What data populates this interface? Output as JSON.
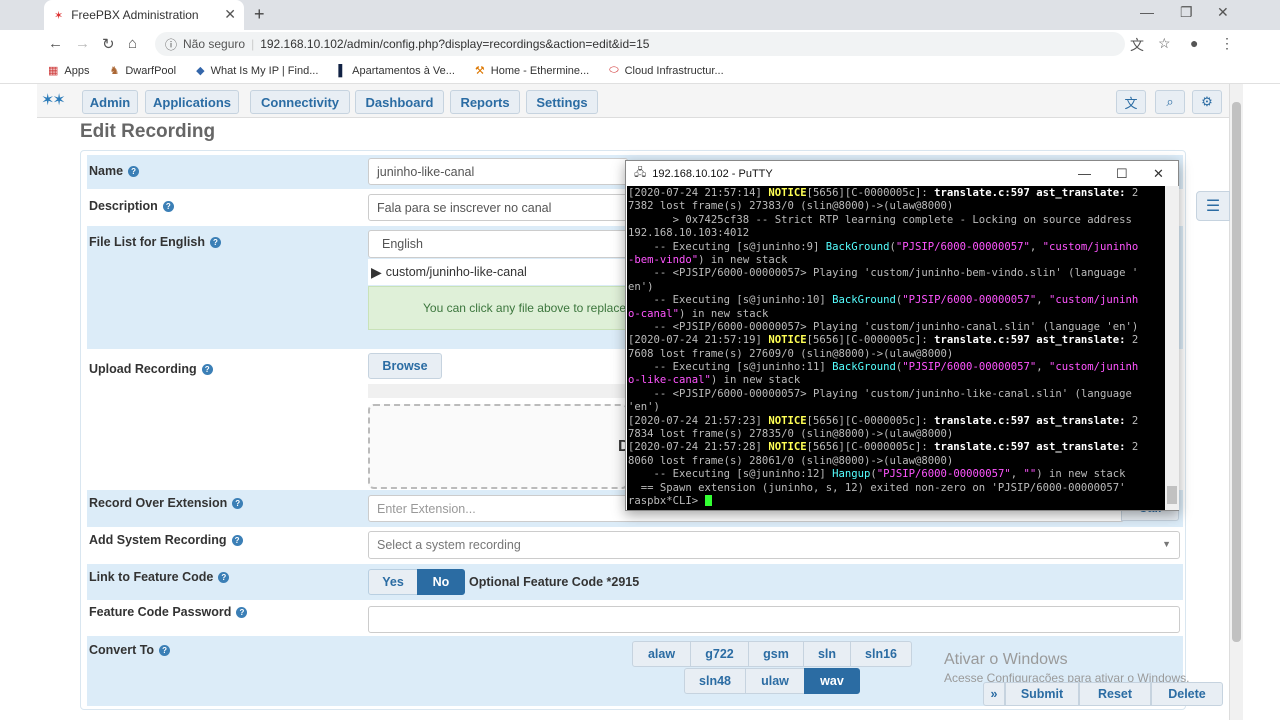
{
  "browser": {
    "tab_title": "FreePBX Administration",
    "security_label": "Não seguro",
    "separator": "|",
    "url": "192.168.10.102/admin/config.php?display=recordings&action=edit&id=15",
    "bookmarks": [
      {
        "label": "Apps"
      },
      {
        "label": "DwarfPool"
      },
      {
        "label": "What Is My IP | Find..."
      },
      {
        "label": "Apartamentos à Ve..."
      },
      {
        "label": "Home - Ethermine..."
      },
      {
        "label": "Cloud Infrastructur..."
      }
    ]
  },
  "nav": {
    "items": [
      "Admin",
      "Applications",
      "Connectivity",
      "Dashboard",
      "Reports",
      "Settings"
    ]
  },
  "page_title": "Edit Recording",
  "form": {
    "name_label": "Name",
    "name_value": "juninho-like-canal",
    "description_label": "Description",
    "description_value": "Fala para se inscrever no canal",
    "filelist_label": "File List for English",
    "language_value": "English",
    "file_item": "custom/juninho-like-canal",
    "file_hint": "You can click any file above to replace",
    "upload_label": "Upload Recording",
    "browse_label": "Browse",
    "drop_partial": "D",
    "record_over_label": "Record Over Extension",
    "record_over_placeholder": "Enter Extension...",
    "call_label": "Call",
    "system_rec_label": "Add System Recording",
    "system_rec_placeholder": "Select a system recording",
    "feature_code_label": "Link to Feature Code",
    "yes_label": "Yes",
    "no_label": "No",
    "feature_code_text": "Optional Feature Code *2915",
    "fc_password_label": "Feature Code Password",
    "convert_label": "Convert To",
    "convert_options": [
      "alaw",
      "g722",
      "gsm",
      "sln",
      "sln16",
      "sln48",
      "ulaw",
      "wav"
    ],
    "active_convert": "wav"
  },
  "actions": {
    "submit": "Submit",
    "reset": "Reset",
    "delete": "Delete"
  },
  "watermark": {
    "line1": "Ativar o Windows",
    "line2": "Acesse Configurações para ativar o Windows."
  },
  "putty": {
    "title": "192.168.10.102 - PuTTY",
    "prompt": "raspbx*CLI> "
  }
}
